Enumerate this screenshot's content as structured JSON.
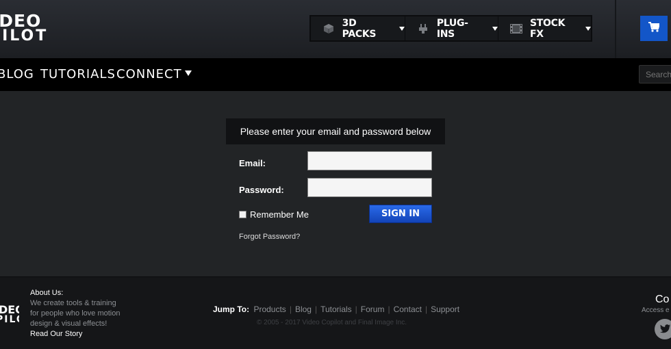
{
  "header": {
    "logo_line1": "IDEO",
    "logo_line2": "PILOT",
    "product_nav": [
      {
        "label": "3D PACKS",
        "icon": "cube-icon"
      },
      {
        "label": "PLUG-INS",
        "icon": "plug-icon"
      },
      {
        "label": "STOCK FX",
        "icon": "film-icon"
      }
    ],
    "cart_icon": "cart-icon",
    "accent": "#1356c8"
  },
  "mainnav": {
    "items": [
      "BLOG",
      "TUTORIALS",
      "CONNECT"
    ],
    "search_placeholder": "Search"
  },
  "login": {
    "heading": "Please enter your email and password below",
    "email_label": "Email:",
    "email_value": "",
    "password_label": "Password:",
    "password_value": "",
    "remember_label": "Remember Me",
    "remember_checked": false,
    "signin_label": "SIGN IN",
    "forgot_label": "Forgot Password?"
  },
  "footer": {
    "logo_line1": "IDEO",
    "logo_line2": "PILOT",
    "about_title": "About Us:",
    "about_text": "We create tools & training for people who love motion design & visual effects!",
    "about_link": "Read Our Story",
    "jump_label": "Jump To:",
    "jump_links": [
      "Products",
      "Blog",
      "Tutorials",
      "Forum",
      "Contact",
      "Support"
    ],
    "copyright": "© 2005 - 2017 Video Copilot and Final Image Inc.",
    "connect_heading": "Co",
    "connect_sub": "Access e",
    "social_icon": "twitter-icon"
  }
}
